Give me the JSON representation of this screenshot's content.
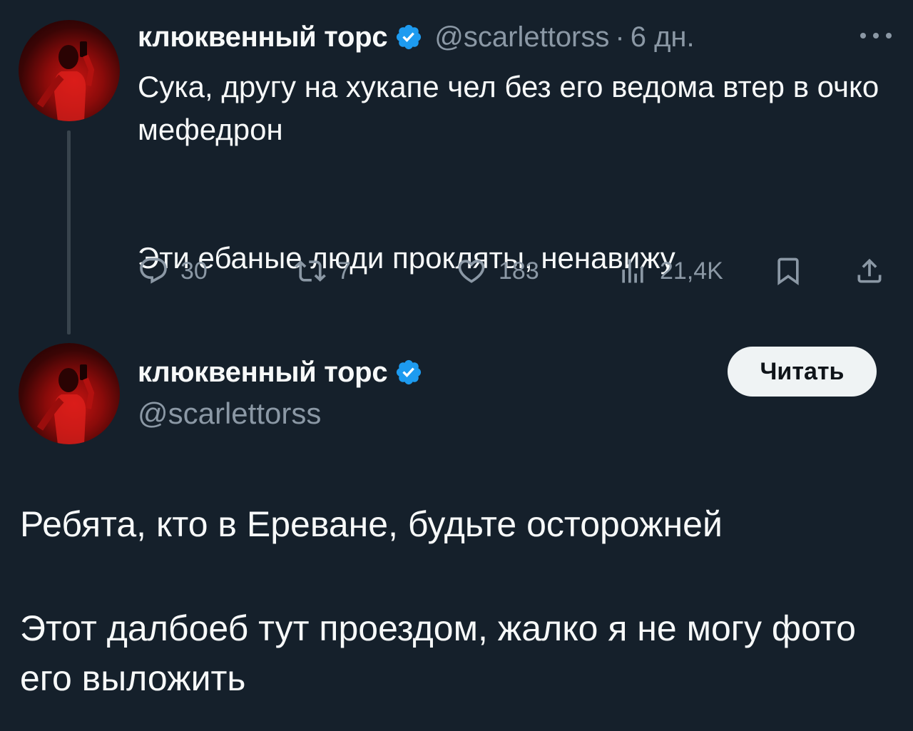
{
  "tweet1": {
    "display_name": "клюквенный торс",
    "handle": "@scarlettorss",
    "separator": "·",
    "time": "6 дн.",
    "text_line1": "Сука, другу на хукапе чел без его ведома втер в очко мефедрон",
    "text_line2": "Эти ебаные люди прокляты, ненавижу",
    "actions": {
      "replies": "30",
      "retweets": "7",
      "likes": "183",
      "views": "21,4K"
    }
  },
  "tweet2": {
    "display_name": "клюквенный торс",
    "handle": "@scarlettorss",
    "follow_label": "Читать",
    "text_line1": "Ребята, кто в Ереване, будьте осторожней",
    "text_line2": "Этот далбоеб тут проездом, жалко я не могу фото его выложить"
  },
  "colors": {
    "background": "#15202b",
    "text": "#f7f9f9",
    "muted": "#8b98a5",
    "verified": "#1d9bf0",
    "avatar_red": "#c81412"
  },
  "icons": [
    "verified-badge-icon",
    "more-icon",
    "reply-icon",
    "retweet-icon",
    "like-icon",
    "views-icon",
    "bookmark-icon",
    "share-icon"
  ]
}
